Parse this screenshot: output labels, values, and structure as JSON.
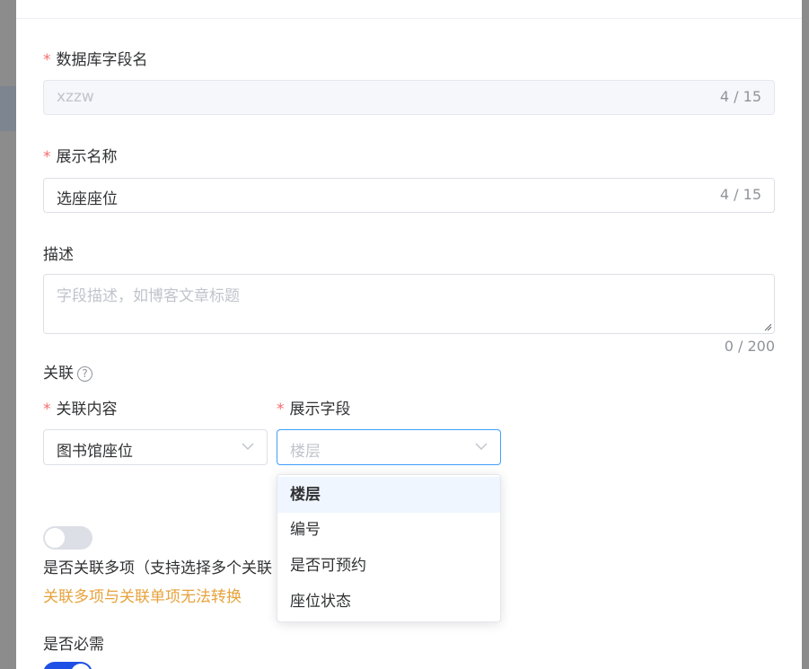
{
  "form": {
    "db_field": {
      "label": "数据库字段名",
      "value": "xzzw",
      "count": "4 / 15"
    },
    "display_name": {
      "label": "展示名称",
      "value": "选座座位",
      "count": "4 / 15"
    },
    "description": {
      "label": "描述",
      "placeholder": "字段描述，如博客文章标题",
      "count": "0 / 200"
    },
    "relation": {
      "label": "关联",
      "content_label": "关联内容",
      "content_value": "图书馆座位",
      "display_field_label": "展示字段",
      "display_field_placeholder": "楼层",
      "options": [
        "楼层",
        "编号",
        "是否可预约",
        "座位状态"
      ]
    },
    "multi": {
      "label": "是否关联多项（支持选择多个关联",
      "warning": "关联多项与关联单项无法转换",
      "enabled": false
    },
    "required": {
      "label": "是否必需",
      "enabled": true
    }
  },
  "icons": {
    "help": "question-circle-icon",
    "chevron": "chevron-down-icon"
  },
  "colors": {
    "required_star": "#f56c6c",
    "focus_border": "#409eff",
    "warning": "#e6a23c",
    "switch_on": "#1e50e6"
  }
}
